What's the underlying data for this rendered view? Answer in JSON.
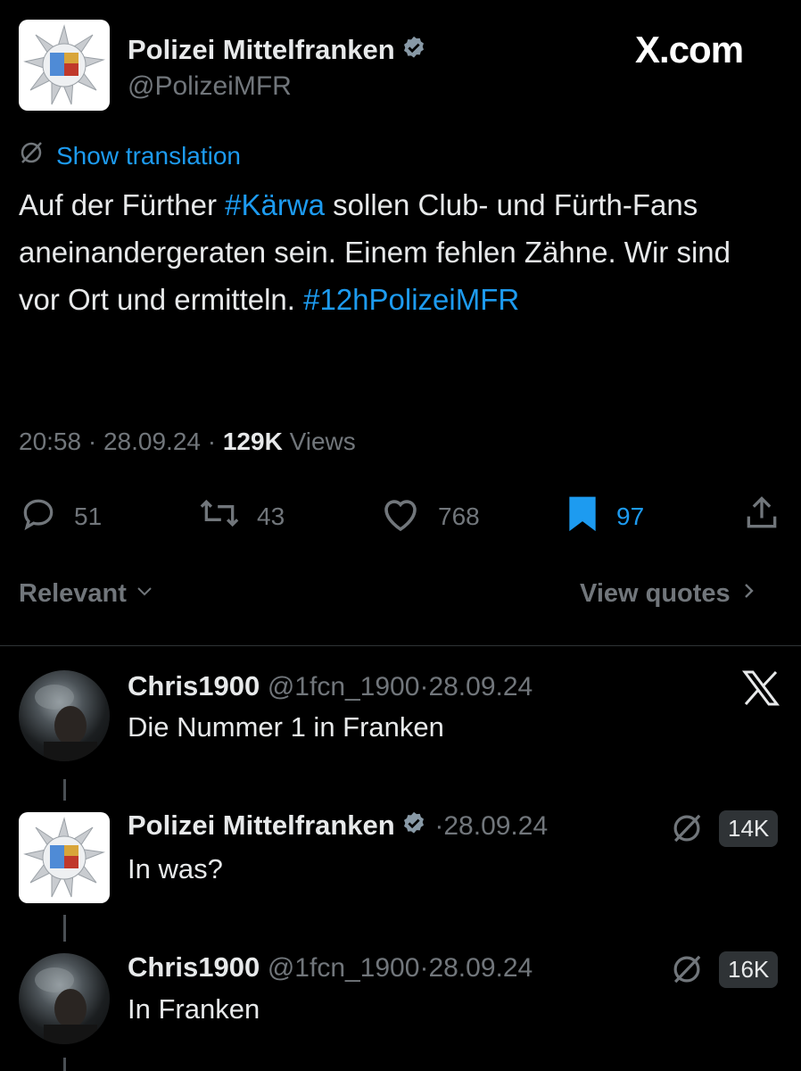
{
  "brand": {
    "watermark": "X.com"
  },
  "tweet": {
    "author_name": "Polizei Mittelfranken",
    "author_handle": "@PolizeiMFR",
    "show_translation": "Show translation",
    "text_parts": [
      "Auf der Fürther ",
      "#Kärwa",
      " sollen Club- und Fürth-Fans aneinandergeraten sein. Einem fehlen Zähne. Wir sind vor Ort und ermitteln. ",
      "#12hPolizeiMFR"
    ],
    "time": "20:58",
    "date": "28.09.24",
    "views_count": "129K",
    "views_label": "Views",
    "replies": "51",
    "reposts": "43",
    "likes": "768",
    "bookmarks": "97"
  },
  "sort": {
    "label": "Relevant",
    "quotes_link": "View quotes"
  },
  "replies": [
    {
      "name": "Chris1900",
      "handle": "@1fcn_1900",
      "date": "28.09.24",
      "text": "Die Nummer 1 in Franken"
    },
    {
      "name": "Polizei Mittelfranken",
      "date": "28.09.24",
      "text": "In was?",
      "badge": "14K"
    },
    {
      "name": "Chris1900",
      "handle": "@1fcn_1900",
      "date": "28.09.24",
      "text": "In Franken",
      "badge": "16K"
    }
  ],
  "colors": {
    "accent": "#1d9bf0",
    "muted": "#71767b",
    "background": "#000000",
    "text": "#e7e9ea"
  },
  "icons": [
    "verified-icon",
    "no-translate-icon",
    "reply-icon",
    "repost-icon",
    "like-icon",
    "bookmark-icon",
    "share-icon",
    "chevron-down-icon",
    "chevron-right-icon",
    "x-logo-icon"
  ]
}
